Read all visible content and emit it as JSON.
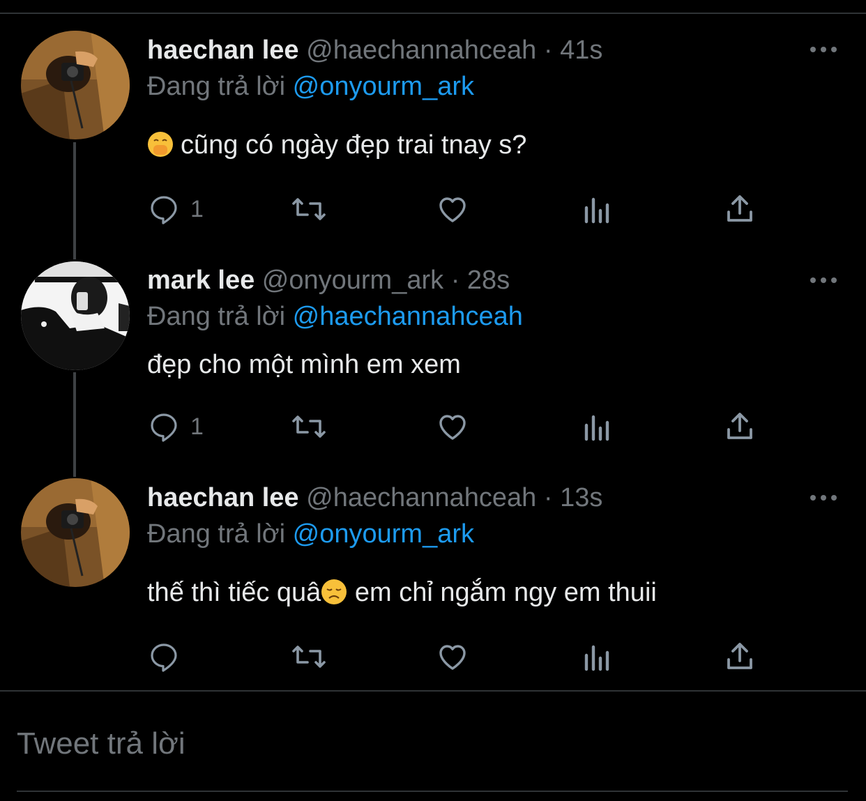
{
  "tweets": [
    {
      "name": "haechan lee",
      "handle": "@haechannahceah",
      "separator": "·",
      "time": "41s",
      "replying_prefix": "Đang trả lời",
      "replying_to": "@onyourm_ark",
      "text": "cũng có ngày đẹp trai tnay s?",
      "text_emoji": "face-with-hand-over-mouth",
      "reply_count": "1",
      "avatar": "haechan-avatar"
    },
    {
      "name": "mark lee",
      "handle": "@onyourm_ark",
      "separator": "·",
      "time": "28s",
      "replying_prefix": "Đang trả lời",
      "replying_to": "@haechannahceah",
      "text": "đẹp cho một mình em xem",
      "reply_count": "1",
      "avatar": "mark-avatar"
    },
    {
      "name": "haechan lee",
      "handle": "@haechannahceah",
      "separator": "·",
      "time": "13s",
      "replying_prefix": "Đang trả lời",
      "replying_to": "@onyourm_ark",
      "text_before_emoji": "thế thì tiếc quâ",
      "text_emoji": "disappointed-face",
      "text_after_emoji": " em chỉ ngắm ngy em thuii",
      "reply_count": "",
      "avatar": "haechan-avatar"
    }
  ],
  "reply_box": {
    "placeholder": "Tweet trả lời"
  },
  "colors": {
    "background": "#000000",
    "text": "#e7e9ea",
    "secondary": "#71767b",
    "accent": "#1d9bf0",
    "divider": "#2f3336"
  },
  "icons": [
    "reply-icon",
    "retweet-icon",
    "like-icon",
    "analytics-icon",
    "share-icon",
    "more-icon"
  ]
}
